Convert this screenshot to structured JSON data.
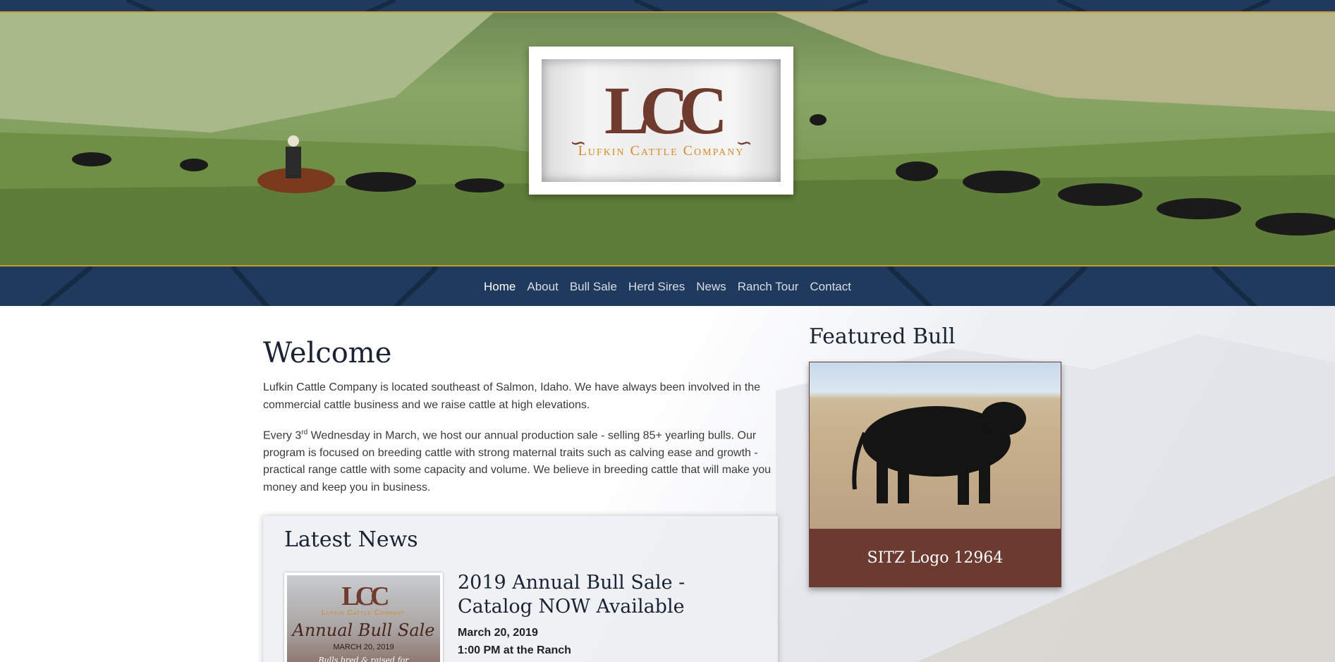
{
  "brand": {
    "logo_mark": "LCC",
    "logo_name": "Lufkin Cattle Company"
  },
  "nav": {
    "items": [
      {
        "label": "Home",
        "active": true
      },
      {
        "label": "About"
      },
      {
        "label": "Bull Sale"
      },
      {
        "label": "Herd Sires"
      },
      {
        "label": "News"
      },
      {
        "label": "Ranch Tour"
      },
      {
        "label": "Contact"
      }
    ]
  },
  "welcome": {
    "title": "Welcome",
    "para1": "Lufkin Cattle Company is located southeast of Salmon, Idaho. We have always been involved in the commercial cattle business and we raise cattle at high elevations.",
    "para2_prefix": "Every 3",
    "para2_sup": "rd",
    "para2_rest": " Wednesday in March, we host our annual production sale - selling 85+ yearling bulls. Our program is focused on breeding cattle with strong maternal traits such as calving ease and growth - practical range cattle with some capacity and volume. We believe in breeding cattle that will make you money and keep you in business."
  },
  "news": {
    "title": "Latest News",
    "item": {
      "title": "2019 Annual Bull Sale - Catalog NOW Available",
      "date": "March 20, 2019",
      "time": "1:00 PM at the Ranch",
      "thumb": {
        "mark": "LCC",
        "brand": "Lufkin Cattle Company",
        "script": "Annual Bull Sale",
        "date": "MARCH 20, 2019",
        "tagline": "Bulls bred & raised for"
      }
    }
  },
  "featured": {
    "title": "Featured Bull",
    "bull_name": "SITZ Logo 12964"
  },
  "colors": {
    "navy": "#1f3a5c",
    "gold": "#c99a2e",
    "brown": "#6b3a30",
    "orange": "#d88a25"
  }
}
